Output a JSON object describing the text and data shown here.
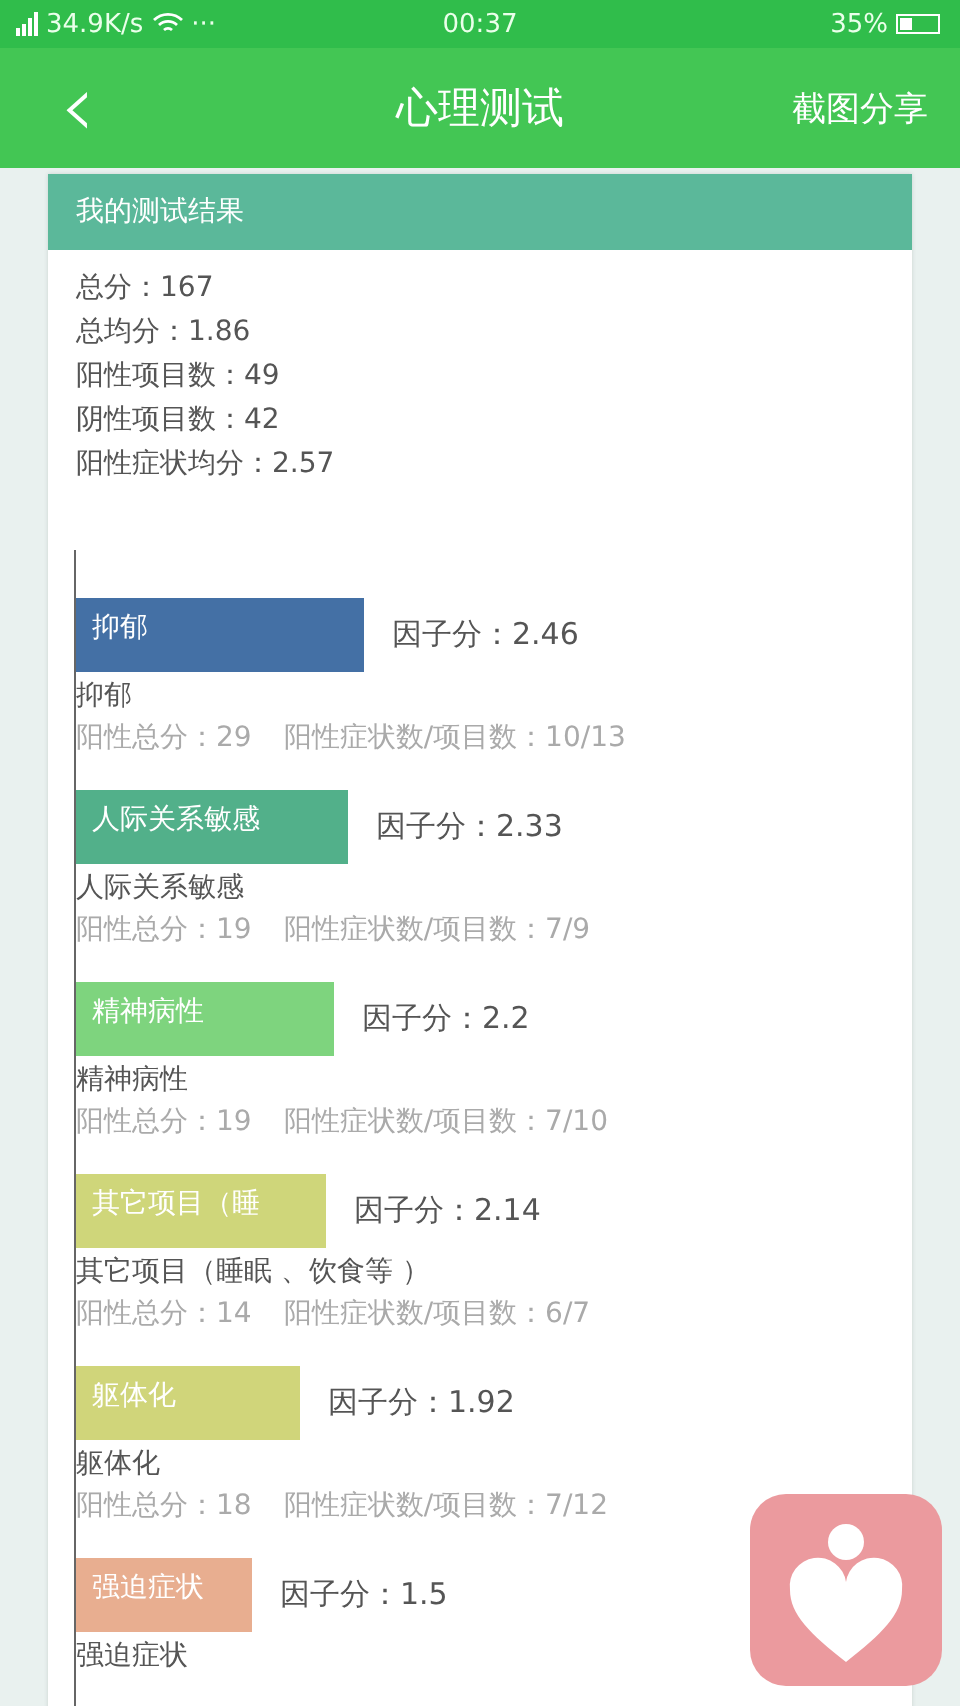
{
  "status_bar": {
    "network": "34.9K/s",
    "more": "···",
    "time": "00:37",
    "battery": "35%"
  },
  "header": {
    "back": "‹",
    "title": "心理测试",
    "action": "截图分享"
  },
  "card": {
    "title": "我的测试结果",
    "summary": [
      "总分：167",
      "总均分：1.86",
      "阳性项目数：49",
      "阴性项目数：42",
      "阳性症状均分：2.57"
    ],
    "factors": [
      {
        "bar_label": "抑郁",
        "score": "因子分：2.46",
        "color": "#4470a5",
        "name": "抑郁",
        "total": "阳性总分：29",
        "ratio": "阳性症状数/项目数：10/13"
      },
      {
        "bar_label": "人际关系敏感",
        "score": "因子分：2.33",
        "color": "#52b08a",
        "name": "人际关系敏感",
        "total": "阳性总分：19",
        "ratio": "阳性症状数/项目数：7/9"
      },
      {
        "bar_label": "精神病性",
        "score": "因子分：2.2",
        "color": "#7ed47e",
        "name": "精神病性",
        "total": "阳性总分：19",
        "ratio": "阳性症状数/项目数：7/10"
      },
      {
        "bar_label": "其它项目（睡",
        "score": "因子分：2.14",
        "color": "#cfd67a",
        "name": "其它项目（睡眠 、饮食等 ）",
        "total": "阳性总分：14",
        "ratio": "阳性症状数/项目数：6/7"
      },
      {
        "bar_label": "躯体化",
        "score": "因子分：1.92",
        "color": "#d0d57a",
        "name": "躯体化",
        "total": "阳性总分：18",
        "ratio": "阳性症状数/项目数：7/12"
      },
      {
        "bar_label": "强迫症状",
        "score": "因子分：1.5",
        "color": "#e8ae90",
        "name": "强迫症状"
      }
    ]
  }
}
